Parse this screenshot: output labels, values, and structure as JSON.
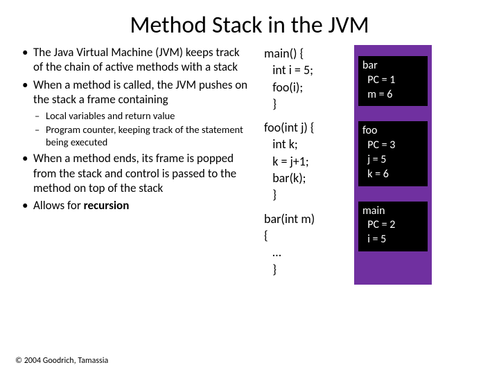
{
  "title": "Method Stack in the JVM",
  "bullets": {
    "b1": "The Java Virtual Machine (JVM) keeps track of the chain of active methods with a stack",
    "b2": "When a method is called, the JVM pushes on the stack a frame containing",
    "s1": "Local variables and return value",
    "s2": "Program counter, keeping track of the statement being executed",
    "b3": "When a method ends, its frame is popped from the stack and control is passed to the method on top of the stack",
    "b4_prefix": "Allows for ",
    "b4_bold": "recursion"
  },
  "copyright": "© 2004 Goodrich, Tamassia",
  "code": {
    "main": "main() {\n   int i = 5;\n   foo(i);\n   }",
    "foo": "foo(int j) {\n   int k;\n   k = j+1;\n   bar(k);\n   }",
    "bar": "bar(int m)\n{\n   …\n   }"
  },
  "frames": {
    "bar": "bar\n  PC = 1\n  m = 6",
    "foo": "foo\n  PC = 3\n  j = 5\n  k = 6",
    "main": "main\n  PC = 2\n  i = 5"
  }
}
